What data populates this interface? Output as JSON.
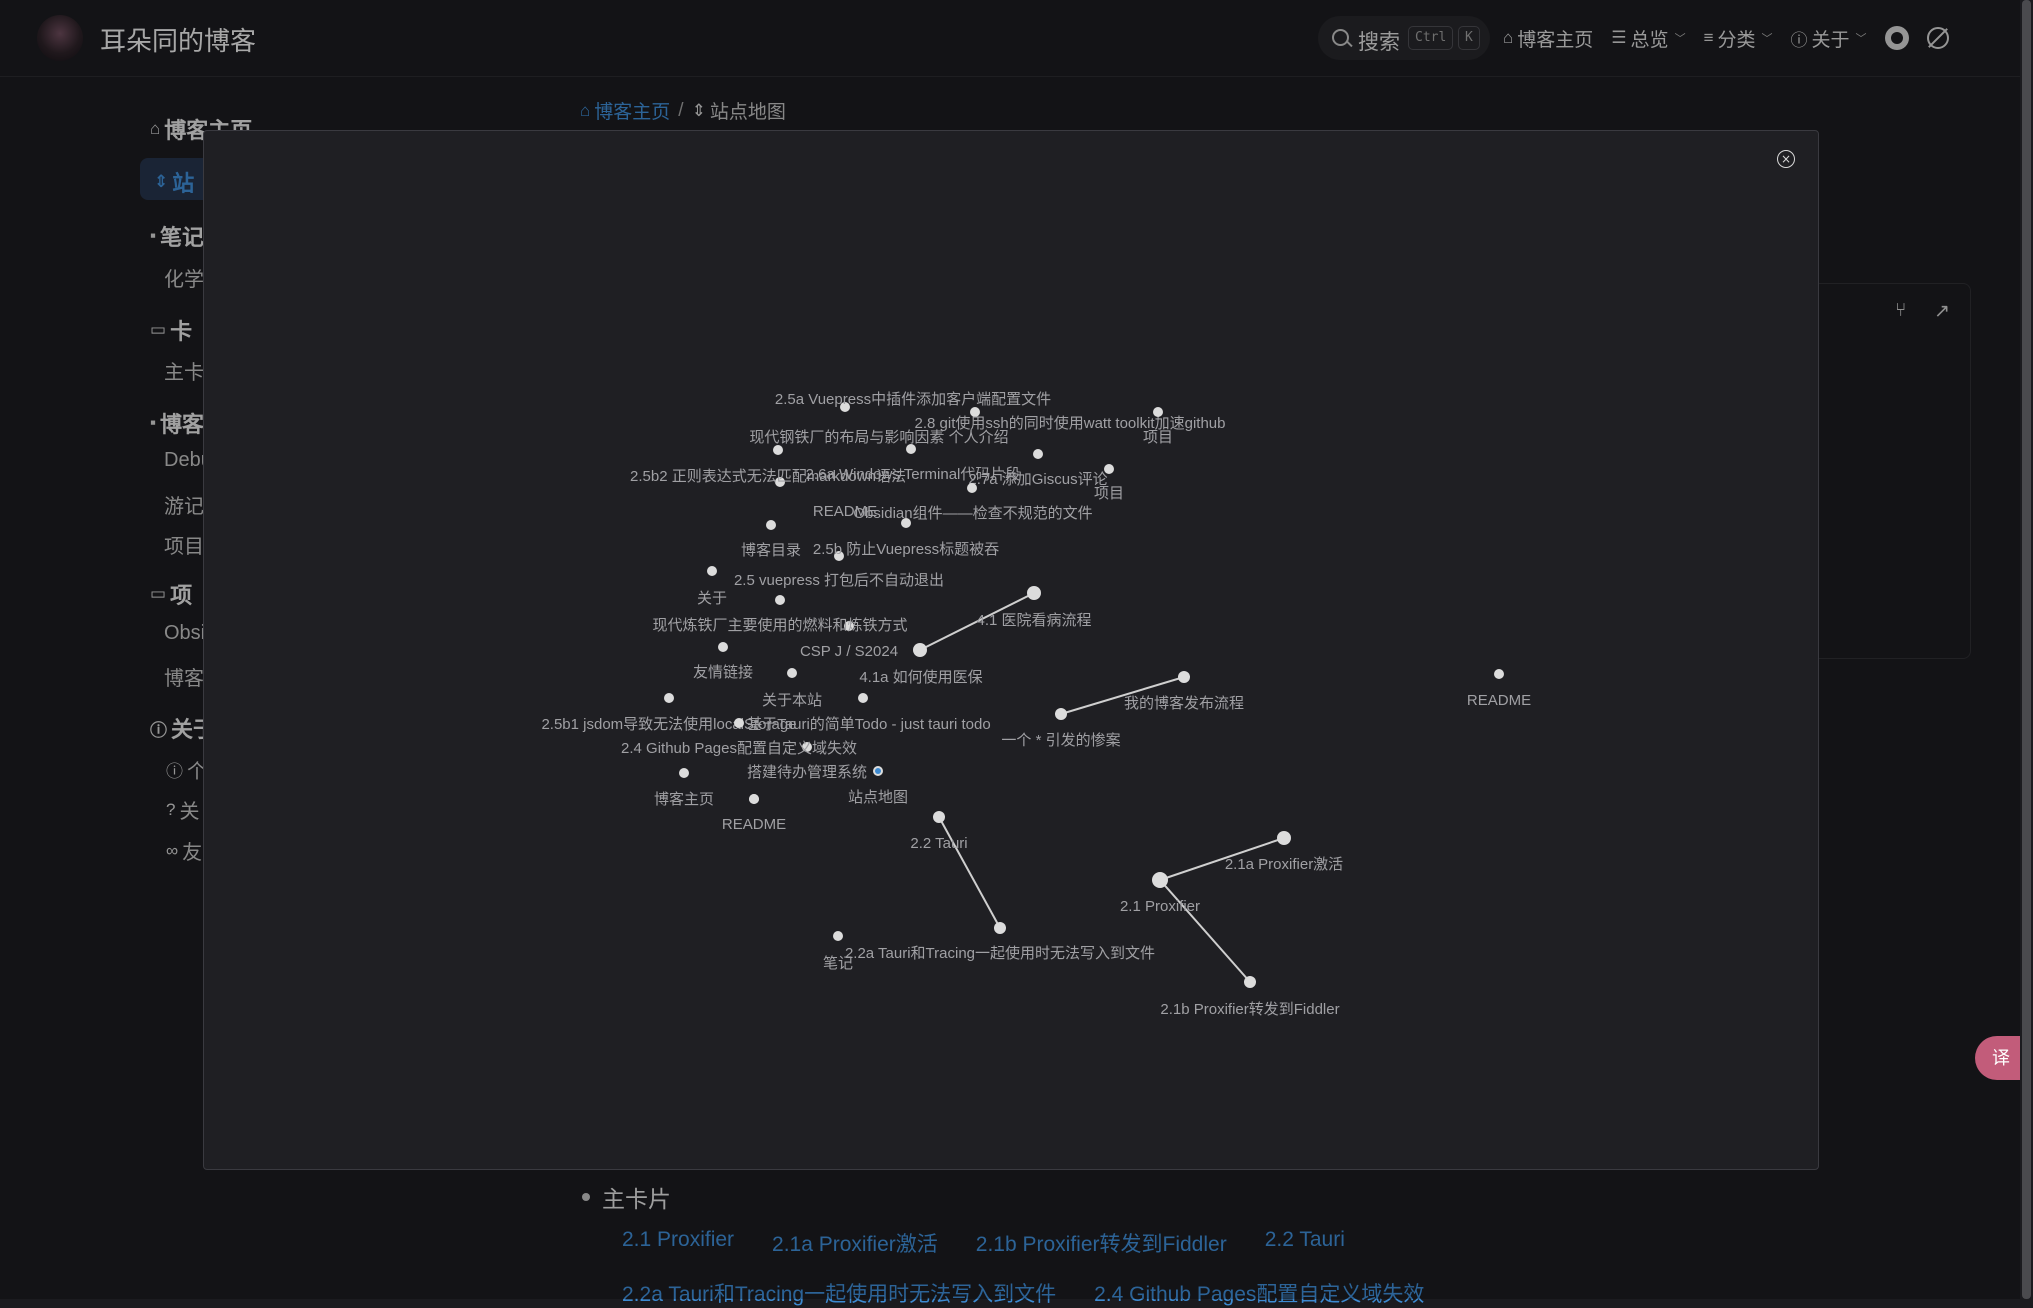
{
  "navbar": {
    "site_title": "耳朵同的博客",
    "search_label": "搜索",
    "search_key1": "Ctrl",
    "search_key2": "K",
    "home": "博客主页",
    "overview": "总览",
    "category": "分类",
    "about": "关于"
  },
  "sidebar": {
    "items": [
      {
        "label": "博客主页"
      },
      {
        "label": "站"
      },
      {
        "label": "笔记"
      },
      {
        "label": "化学"
      },
      {
        "label": "卡"
      },
      {
        "label": "主卡"
      },
      {
        "label": "博客"
      },
      {
        "label": "Debu"
      },
      {
        "label": "游记"
      },
      {
        "label": "项目"
      },
      {
        "label": "项"
      },
      {
        "label": "Obsi"
      },
      {
        "label": "博客"
      },
      {
        "label": "关于"
      },
      {
        "label": "个"
      },
      {
        "label": "关"
      },
      {
        "label": "友"
      }
    ]
  },
  "breadcrumb": {
    "home": "博客主页",
    "separator": "/",
    "current": "站点地图"
  },
  "content": {
    "section_title": "主卡片",
    "tags_row1": [
      "2.1 Proxifier",
      "2.1a Proxifier激活",
      "2.1b Proxifier转发到Fiddler",
      "2.2 Tauri"
    ],
    "tags_row2": [
      "2.2a Tauri和Tracing一起使用时无法写入到文件",
      "2.4 Github Pages配置自定义域失效"
    ]
  },
  "modal": {
    "close_glyph": "×",
    "nodes": [
      {
        "label": "2.5a Vuepress中插件添加客户端配置文件"
      },
      {
        "label": "2.8 git使用ssh的同时使用watt toolkit加速github"
      },
      {
        "label": "项目"
      },
      {
        "label": "现代钢铁厂的布局与影响因素 个人介绍"
      },
      {
        "label": "2.5b2 正则表达式无法匹配markdown语法"
      },
      {
        "label": "2.6a Windows Terminal代码片段"
      },
      {
        "label": "2.7a 添加Giscus评论"
      },
      {
        "label": "项目"
      },
      {
        "label": "README"
      },
      {
        "label": "Obsidian组件——检查不规范的文件"
      },
      {
        "label": "博客目录"
      },
      {
        "label": "2.5b 防止Vuepress标题被吞"
      },
      {
        "label": "2.5 vuepress 打包后不自动退出"
      },
      {
        "label": "关于"
      },
      {
        "label": "现代炼铁厂主要使用的燃料和炼铁方式"
      },
      {
        "label": "4.1 医院看病流程"
      },
      {
        "label": "CSP J / S2024"
      },
      {
        "label": "友情链接"
      },
      {
        "label": "4.1a 如何使用医保"
      },
      {
        "label": "README"
      },
      {
        "label": "关于本站"
      },
      {
        "label": "我的博客发布流程"
      },
      {
        "label": "2.5b1 jsdom导致无法使用localStorage"
      },
      {
        "label": "基于Tauri的简单Todo - just tauri todo"
      },
      {
        "label": "一个 * 引发的惨案"
      },
      {
        "label": "2.4 Github Pages配置自定义域失效"
      },
      {
        "label": "搭建待办管理系统"
      },
      {
        "label": "博客主页"
      },
      {
        "label": "站点地图"
      },
      {
        "label": "README"
      },
      {
        "label": "2.2 Tauri"
      },
      {
        "label": "2.1a Proxifier激活"
      },
      {
        "label": "2.1 Proxifier"
      },
      {
        "label": "笔记"
      },
      {
        "label": "2.2a Tauri和Tracing一起使用时无法写入到文件"
      },
      {
        "label": "2.1b Proxifier转发到Fiddler"
      }
    ]
  },
  "colors": {
    "accent": "#3d8ad1",
    "background": "#1b1b1f",
    "modal_bg": "#1f1f23",
    "node": "#dcdcdc",
    "link": "#cfcfcf",
    "translate_button": "#c25c7a"
  }
}
